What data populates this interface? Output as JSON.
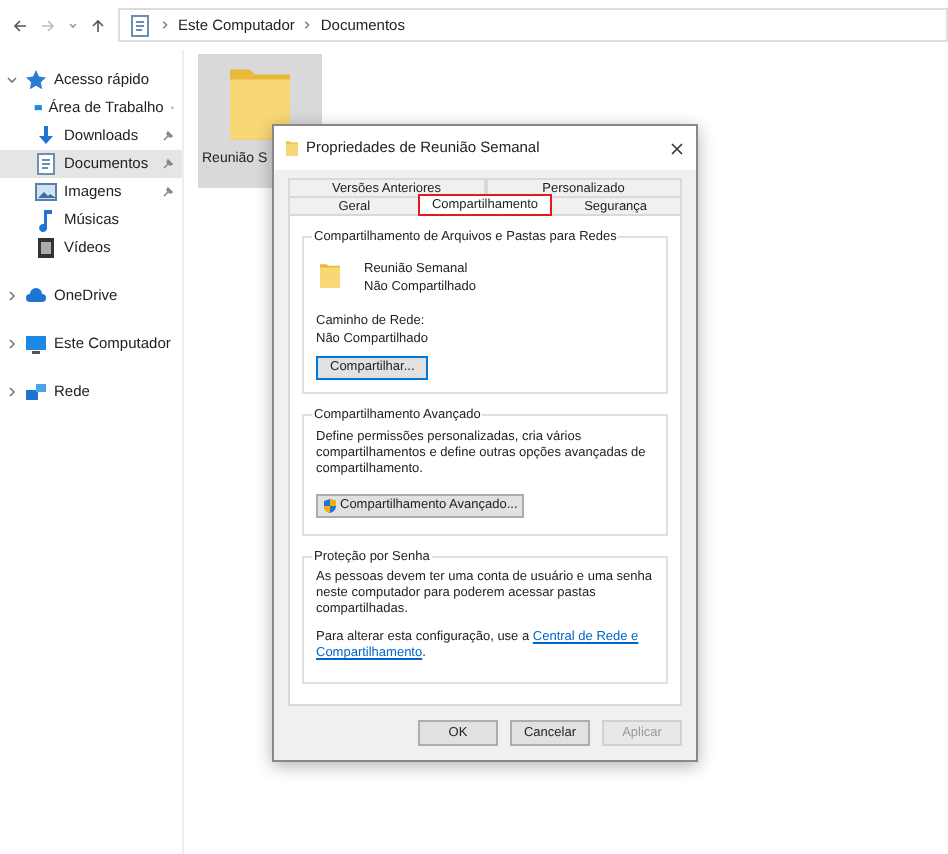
{
  "address_bar": {
    "path": [
      "Este Computador",
      "Documentos"
    ]
  },
  "sidebar": {
    "items": [
      {
        "label": "Acesso rápido",
        "kind": "star",
        "expanded": true,
        "selected": false,
        "children": [
          {
            "label": "Área de Trabalho",
            "kind": "desktop",
            "pinned": true,
            "selected": false
          },
          {
            "label": "Downloads",
            "kind": "download",
            "pinned": true,
            "selected": false
          },
          {
            "label": "Documentos",
            "kind": "document",
            "pinned": true,
            "selected": true
          },
          {
            "label": "Imagens",
            "kind": "image",
            "pinned": true,
            "selected": false
          },
          {
            "label": "Músicas",
            "kind": "music",
            "pinned": false,
            "selected": false
          },
          {
            "label": "Vídeos",
            "kind": "video",
            "pinned": false,
            "selected": false
          }
        ]
      },
      {
        "label": "OneDrive",
        "kind": "cloud",
        "expanded": false,
        "selected": false
      },
      {
        "label": "Este Computador",
        "kind": "computer",
        "expanded": false,
        "selected": false
      },
      {
        "label": "Rede",
        "kind": "network",
        "expanded": false,
        "selected": false
      }
    ]
  },
  "files": [
    {
      "label": "Reunião S",
      "selected": true
    }
  ],
  "dialog": {
    "title": "Propriedades de Reunião Semanal",
    "tab_rows": [
      [
        {
          "label": "Versões Anteriores",
          "selected": false,
          "highlighted": false
        },
        {
          "label": "Personalizado",
          "selected": false,
          "highlighted": false
        }
      ],
      [
        {
          "label": "Geral",
          "selected": false,
          "highlighted": false
        },
        {
          "label": "Compartilhamento",
          "selected": true,
          "highlighted": true
        },
        {
          "label": "Segurança",
          "selected": false,
          "highlighted": false
        }
      ]
    ],
    "sharing": {
      "title": "Compartilhamento de Arquivos e Pastas para Redes",
      "name": "Reunião Semanal",
      "status": "Não Compartilhado",
      "path_label": "Caminho de Rede:",
      "path_value": "Não Compartilhado",
      "button": "Compartilhar..."
    },
    "advanced": {
      "title": "Compartilhamento Avançado",
      "description": "Define permissões personalizadas, cria vários compartilhamentos e define outras opções avançadas de compartilhamento.",
      "button": "Compartilhamento Avançado..."
    },
    "password": {
      "title": "Proteção por Senha",
      "description": "As pessoas devem ter uma conta de usuário e uma senha neste computador para poderem acessar pastas compartilhadas.",
      "change_text": "Para alterar esta configuração, use a",
      "link_lines": [
        "Central de Rede e",
        "Compartilhamento"
      ],
      "link_end": "."
    },
    "buttons": [
      {
        "label": "OK",
        "disabled": false
      },
      {
        "label": "Cancelar",
        "disabled": false
      },
      {
        "label": "Aplicar",
        "disabled": true
      }
    ]
  }
}
